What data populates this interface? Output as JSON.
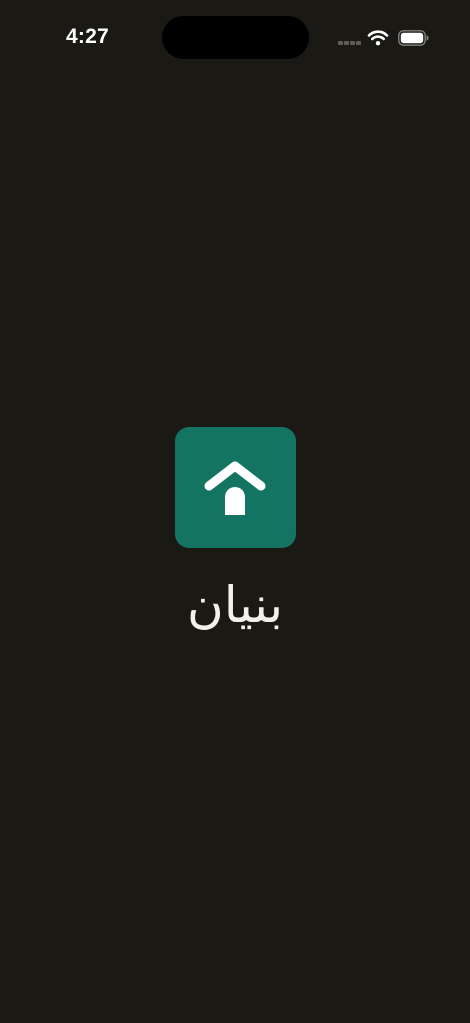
{
  "status_bar": {
    "time": "4:27",
    "signal_icon": "cellular-signal-icon",
    "wifi_icon": "wifi-icon",
    "battery_icon": "battery-icon"
  },
  "splash": {
    "logo_icon": "house-icon",
    "app_name": "بنيان"
  },
  "colors": {
    "background": "#1a1914",
    "brand": "#137462",
    "text": "#f3f1e9"
  }
}
